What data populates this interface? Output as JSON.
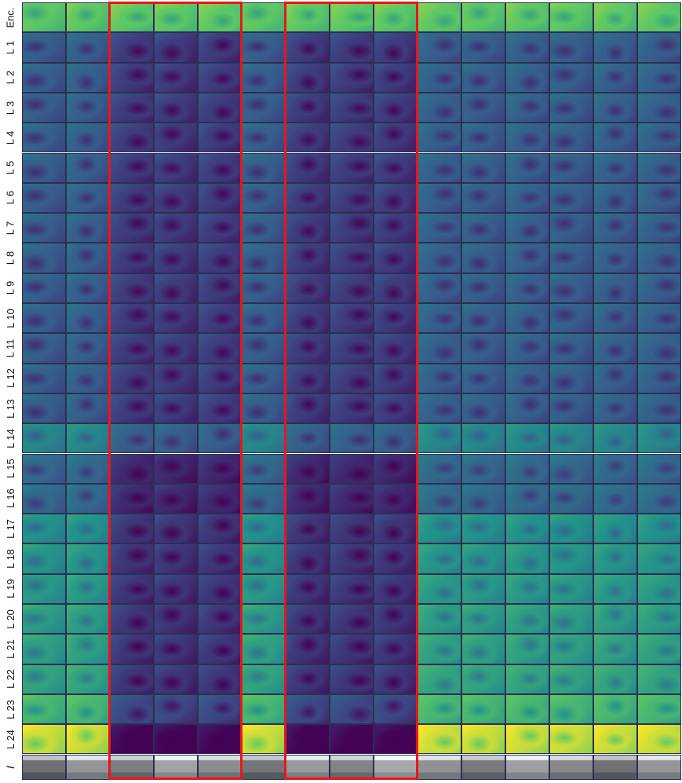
{
  "rows": [
    "Enc.",
    "L 1",
    "L 2",
    "L 3",
    "L 4",
    "L 5",
    "L 6",
    "L 7",
    "L 8",
    "L 9",
    "L 10",
    "L 11",
    "L 12",
    "L 13",
    "L 14",
    "L 15",
    "L 16",
    "L 17",
    "L 18",
    "L 19",
    "L 20",
    "L 21",
    "L 22",
    "L 23",
    "L 24",
    "I"
  ],
  "column_count": 15,
  "highlighted_column_groups": [
    [
      2,
      4
    ],
    [
      6,
      8
    ]
  ],
  "colormap": [
    "#440154",
    "#3b528b",
    "#21918c",
    "#5ec962",
    "#fde725"
  ],
  "highlight_color": "#e8161b"
}
